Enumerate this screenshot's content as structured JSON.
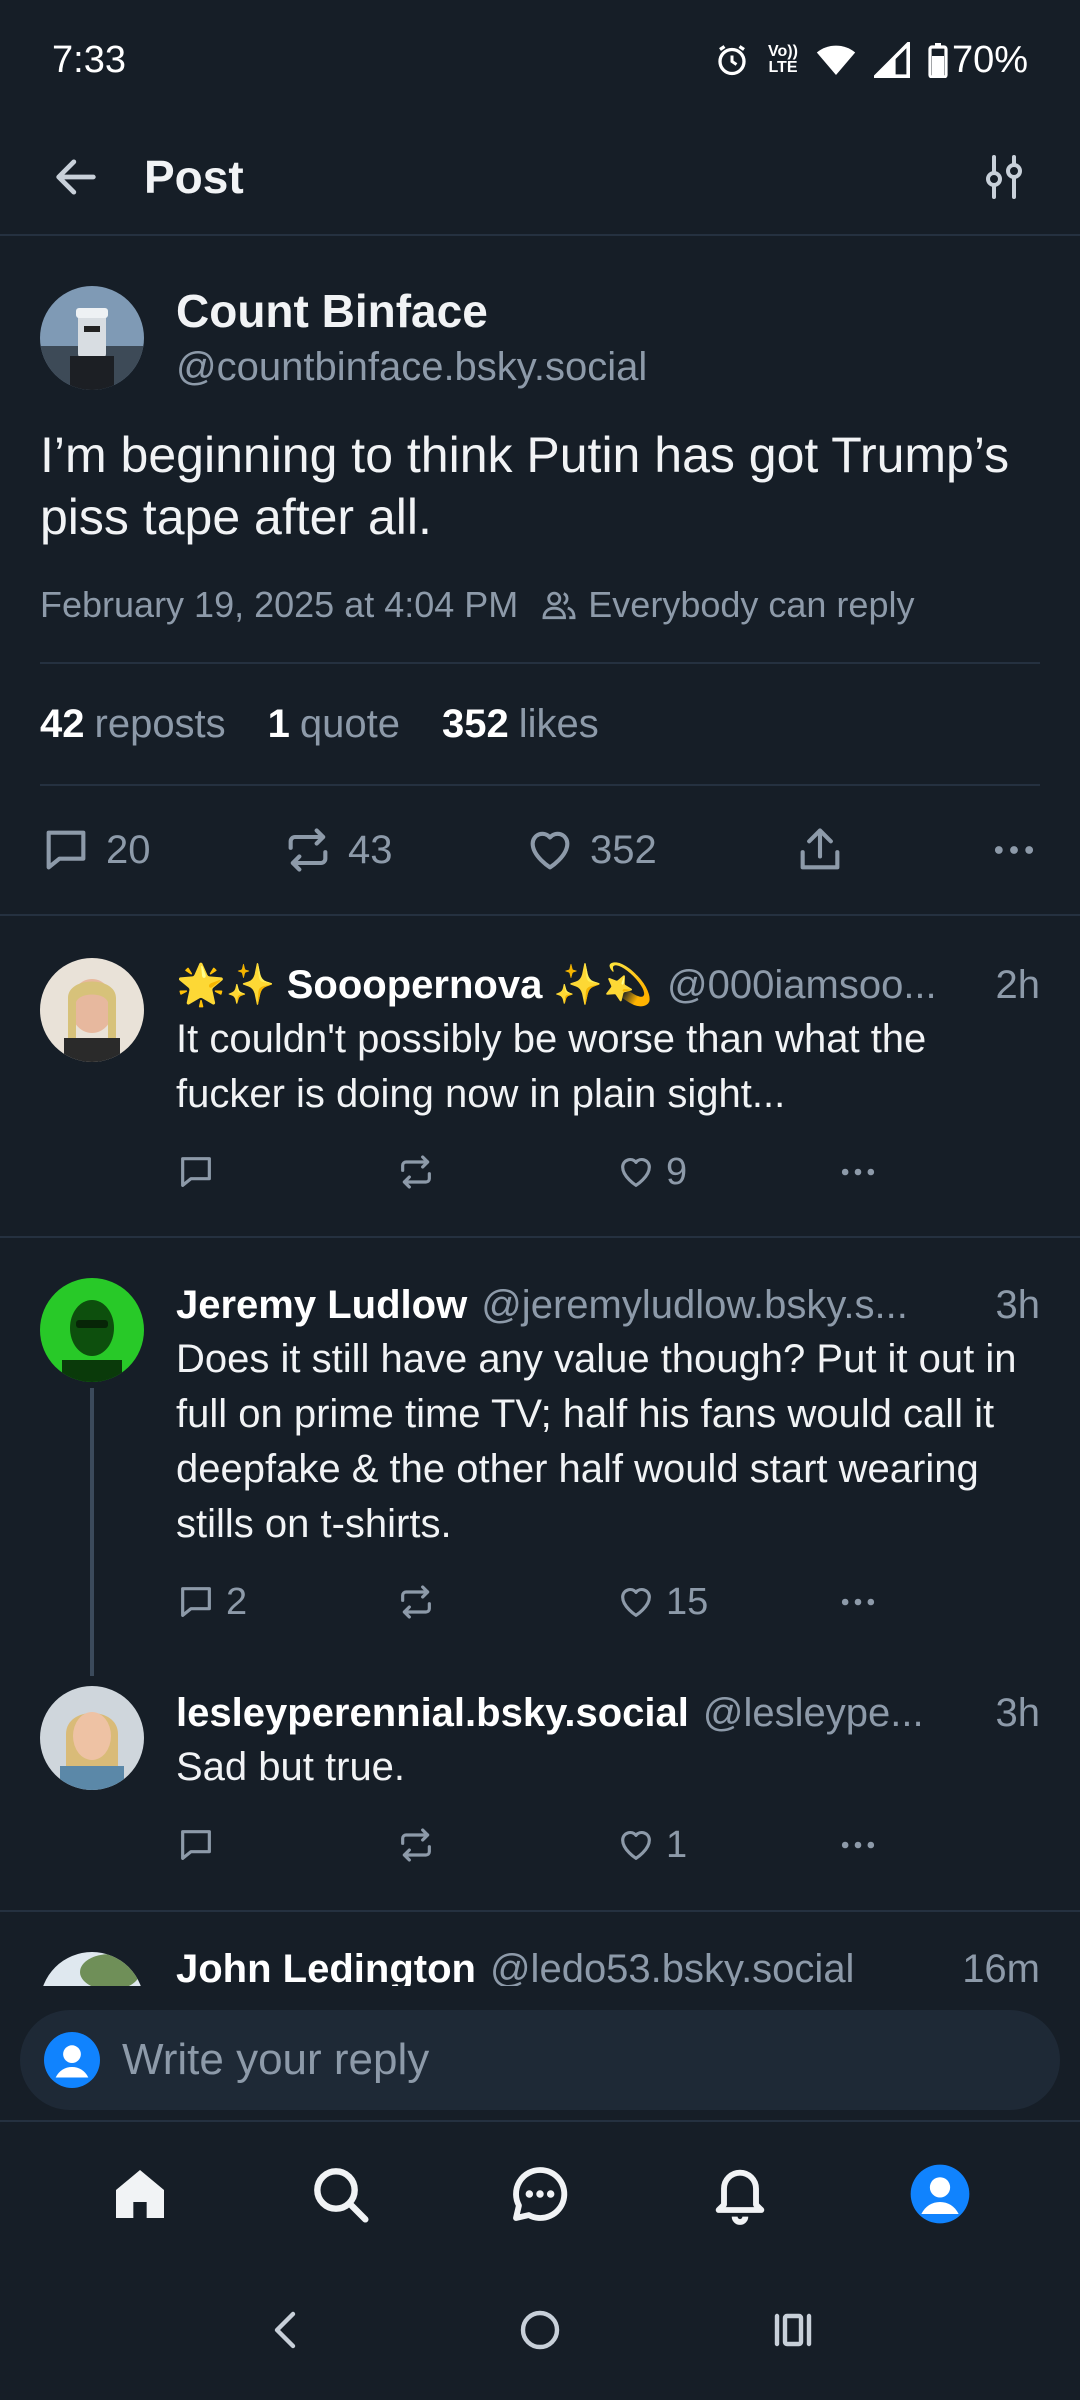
{
  "status_bar": {
    "time": "7:33",
    "lte_top": "Vo))",
    "lte_bottom": "LTE",
    "battery": "70%"
  },
  "header": {
    "title": "Post"
  },
  "post": {
    "author_name": "Count Binface",
    "author_handle": "@countbinface.bsky.social",
    "text": "I’m beginning to think Putin has got Trump’s piss tape after all.",
    "timestamp": "February 19, 2025 at 4:04 PM",
    "reply_setting": "Everybody can reply",
    "stats": {
      "reposts_count": "42",
      "reposts_label": "reposts",
      "quotes_count": "1",
      "quotes_label": "quote",
      "likes_count": "352",
      "likes_label": "likes"
    },
    "actions": {
      "replies": "20",
      "reposts": "43",
      "likes": "352"
    }
  },
  "replies": [
    {
      "name": "🌟✨ Sooopernova ✨💫",
      "handle": "@000iamsoo...",
      "age": "2h",
      "text": "It couldn't possibly be worse than what the fucker is doing now in plain sight...",
      "reply_count": "",
      "like_count": "9"
    },
    {
      "name": "Jeremy Ludlow",
      "handle": "@jeremyludlow.bsky.s...",
      "age": "3h",
      "text": "Does it still have any value though? Put it out in full on prime time TV; half his fans would call it deepfake & the other half would start wearing stills on t-shirts.",
      "reply_count": "2",
      "like_count": "15"
    },
    {
      "name": "lesleyperennial.bsky.social",
      "handle": "@lesleype...",
      "age": "3h",
      "text": "Sad but true.",
      "reply_count": "",
      "like_count": "1"
    },
    {
      "name": "John Ledington",
      "handle": "@ledo53.bsky.social",
      "age": "16m"
    }
  ],
  "composer": {
    "placeholder": "Write your reply"
  },
  "colors": {
    "background": "#161e27",
    "accent": "#1083fe",
    "muted": "#8d9aa9",
    "divider": "#253140"
  },
  "icons": [
    "back-arrow-icon",
    "filter-sliders-icon",
    "people-icon",
    "comment-icon",
    "repost-icon",
    "heart-icon",
    "share-icon",
    "more-icon",
    "home-icon",
    "search-icon",
    "chat-icon",
    "bell-icon",
    "profile-icon"
  ]
}
